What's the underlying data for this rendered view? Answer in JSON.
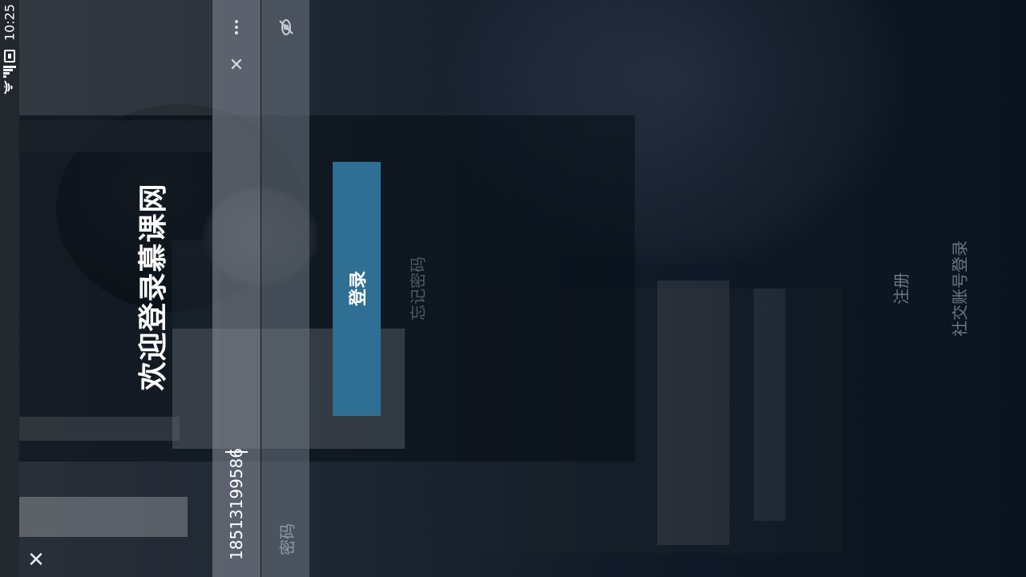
{
  "status_bar": {
    "time": "10:25",
    "icons": [
      "battery-icon",
      "signal-icon",
      "wifi-icon"
    ]
  },
  "header": {
    "welcome_title": "欢迎登录慕课网"
  },
  "form": {
    "phone_value": "18513199586",
    "password_placeholder": "密码",
    "login_label": "登录"
  },
  "links": {
    "forgot_password": "忘记密码",
    "register": "注册",
    "social_login": "社交账号登录"
  },
  "colors": {
    "primary_button": "#2f6f93",
    "background": "#0e1725"
  },
  "icons": {
    "more": "more-vertical-icon",
    "clear": "clear-icon",
    "password_visibility": "eye-off-icon",
    "close": "close-icon"
  }
}
